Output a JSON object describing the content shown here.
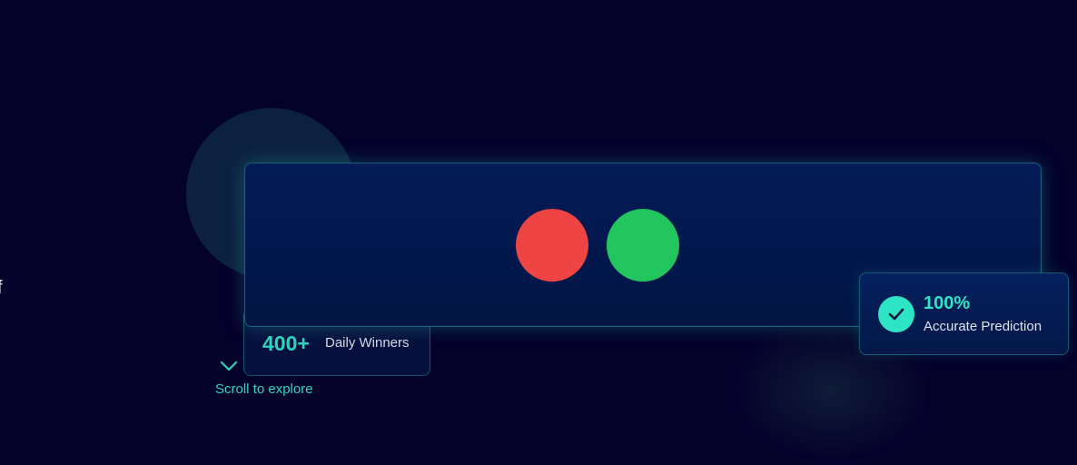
{
  "page": {
    "partial_text": "f"
  },
  "stats": {
    "winners_value": "400+",
    "winners_label": "Daily Winners",
    "accuracy_value": "100%",
    "accuracy_label": "Accurate Prediction"
  },
  "scroll": {
    "label": "Scroll to explore",
    "icon": "chevron-down-icon"
  },
  "indicators": {
    "colors": [
      "#ef4444",
      "#22c55e"
    ]
  }
}
